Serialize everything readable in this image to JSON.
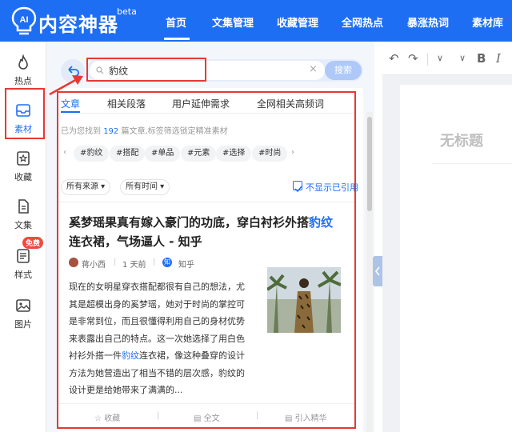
{
  "header": {
    "logo_text": "AI",
    "brand": "内容神器",
    "beta": "beta",
    "nav": [
      "首页",
      "文集管理",
      "收藏管理",
      "全网热点",
      "暴涨热词",
      "素材库"
    ]
  },
  "sidebar": {
    "items": [
      {
        "label": "热点"
      },
      {
        "label": "素材"
      },
      {
        "label": "收藏"
      },
      {
        "label": "文集"
      },
      {
        "label": "样式",
        "badge": "免费"
      },
      {
        "label": "图片"
      }
    ]
  },
  "search": {
    "query": "豹纹",
    "clear": "×",
    "button": "搜索"
  },
  "tabs": [
    "文章",
    "相关段落",
    "用户延伸需求",
    "全网相关高频词"
  ],
  "summary": {
    "prefix": "已为您找到 ",
    "count": "192",
    "suffix": " 篇文章,标签筛选锁定精准素材"
  },
  "tags": [
    "#豹纹",
    "#搭配",
    "#单品",
    "#元素",
    "#选择",
    "#时尚"
  ],
  "filters": {
    "source": "所有来源",
    "time": "所有时间",
    "hide_cited": "不显示已引用"
  },
  "article": {
    "title_before": "奚梦瑶果真有嫁入豪门的功底，穿白衬衫外搭",
    "title_highlight": "豹纹",
    "title_after": "连衣裙，气场逼人 - 知乎",
    "author": "蒋小西",
    "time": "1 天前",
    "source_icon": "知",
    "source": "知乎",
    "body_before": "现在的女明星穿衣搭配都很有自己的想法，尤其是超模出身的奚梦瑶，她对于时尚的掌控可是非常到位，而且很懂得利用自己的身材优势来表露出自己的特点。这一次她选择了用白色衬衫外搭一件",
    "body_highlight": "豹纹",
    "body_after": "连衣裙，像这种叠穿的设计方法为她营造出了相当不错的层次感，豹纹的设计更是给她带来了满满的..."
  },
  "actions": [
    "收藏",
    "全文",
    "引入精华"
  ],
  "editor": {
    "title_placeholder": "无标题",
    "bold": "B",
    "italic": "I"
  },
  "colors": {
    "brand_blue": "#1e6ef4",
    "annotation_red": "#e53935"
  }
}
